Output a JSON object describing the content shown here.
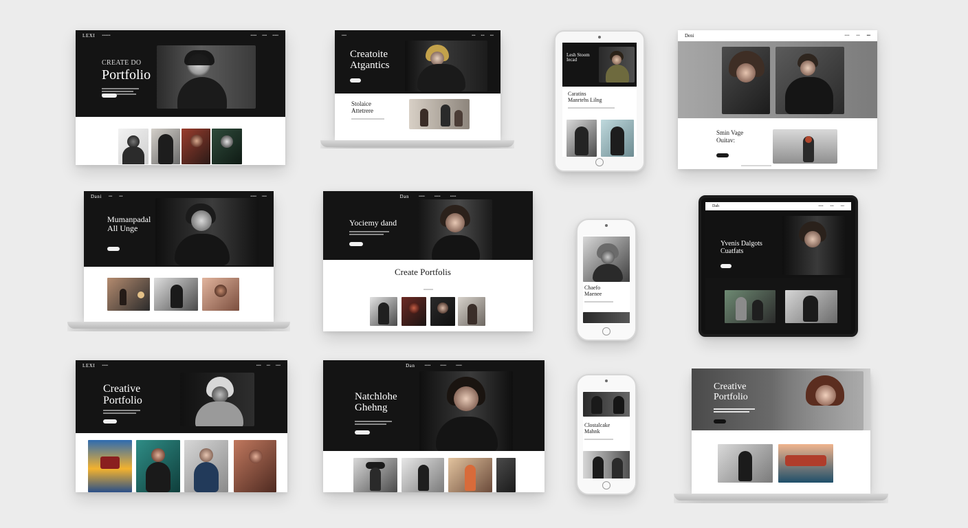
{
  "mockups": [
    {
      "id": "m1",
      "brand": "LEXI",
      "headline_line1": "CREATE DO",
      "headline_line2": "Portfolio",
      "nav": [
        "About",
        "Work",
        "Contact"
      ],
      "colors": {
        "accent": "#141414"
      }
    },
    {
      "id": "m2",
      "headline_line1": "Creatoite",
      "headline_line2": "Atgantics",
      "section_title_line1": "Stolaice",
      "section_title_line2": "Attetrere"
    },
    {
      "id": "m3",
      "headline_line1": "Lesh Stoom",
      "headline_line2": "Iecad",
      "section_title_line1": "Caratins",
      "section_title_line2": "Manrtehs Lilng"
    },
    {
      "id": "m4",
      "brand": "Deni",
      "section_title_line1": "Smin Vage",
      "section_title_line2": "Ouitav:"
    },
    {
      "id": "m5",
      "brand": "Dani",
      "headline_line1": "Mumanpadal",
      "headline_line2": "All Unge"
    },
    {
      "id": "m6",
      "brand": "Dan",
      "headline": "Yociemy dand",
      "section_title": "Create Portfolis"
    },
    {
      "id": "m7",
      "section_title_line1": "Chaefo",
      "section_title_line2": "Maenee"
    },
    {
      "id": "m8",
      "brand": "Dah",
      "headline_line1": "Yvenis Dalgots",
      "headline_line2": "Cuatfats"
    },
    {
      "id": "m9",
      "brand": "LEXI",
      "headline_line1": "Creative",
      "headline_line2": "Portfolio"
    },
    {
      "id": "m10",
      "brand": "Dan",
      "headline_line1": "Natchlohe",
      "headline_line2": "Ghehng"
    },
    {
      "id": "m11",
      "section_title_line1": "Clostalcake",
      "section_title_line2": "Mahnk"
    },
    {
      "id": "m12",
      "headline_line1": "Creative",
      "headline_line2": "Portfolio"
    }
  ],
  "ui": {
    "button_label": "",
    "icons": {
      "home": "home-button-icon"
    }
  }
}
